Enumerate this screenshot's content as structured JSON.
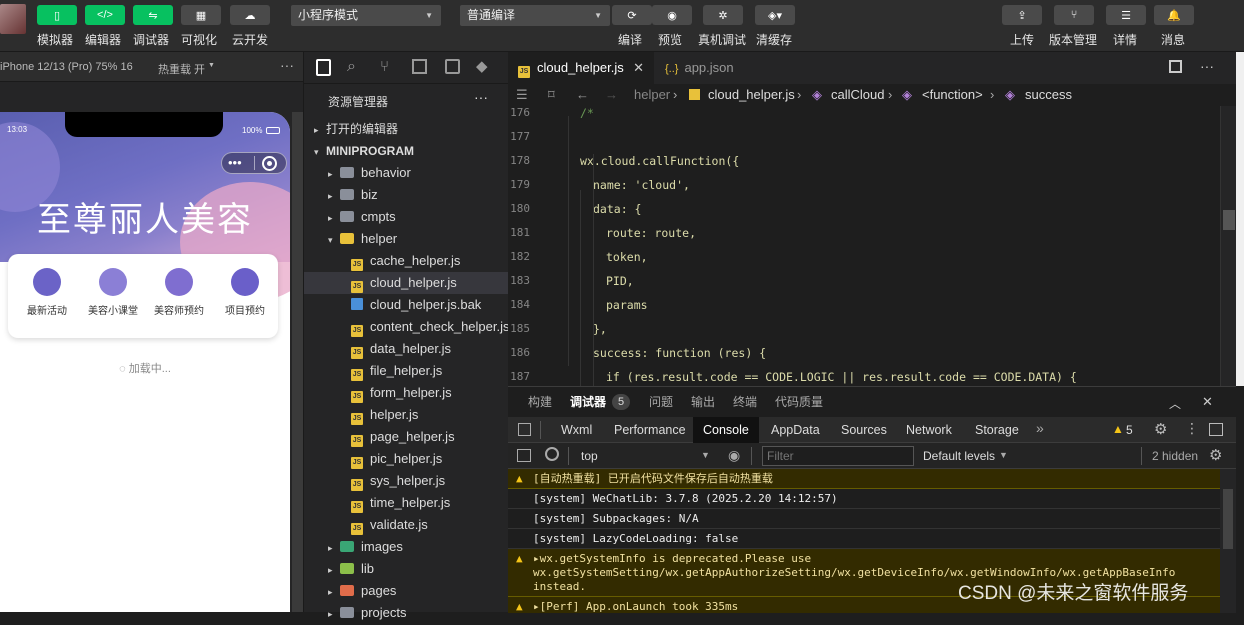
{
  "toolbar": {
    "left_buttons": [
      {
        "icon": "phone-icon",
        "label": "模拟器"
      },
      {
        "icon": "code-icon",
        "label": "编辑器"
      },
      {
        "icon": "debug-icon",
        "label": "调试器"
      },
      {
        "icon": "layout-icon",
        "label": "可视化"
      },
      {
        "icon": "cloud-icon",
        "label": "云开发"
      }
    ],
    "mode_select": "小程序模式",
    "compile_select": "普通编译",
    "mid_buttons": [
      {
        "icon": "refresh-icon",
        "label": "编译"
      },
      {
        "icon": "eye-icon",
        "label": "预览"
      },
      {
        "icon": "bug-icon",
        "label": "真机调试"
      },
      {
        "icon": "layers-icon",
        "label": "清缓存"
      }
    ],
    "right_buttons": [
      {
        "icon": "upload-icon",
        "label": "上传"
      },
      {
        "icon": "branch-icon",
        "label": "版本管理"
      },
      {
        "icon": "menu-icon",
        "label": "详情"
      },
      {
        "icon": "bell-icon",
        "label": "消息"
      }
    ]
  },
  "simulator": {
    "device": "iPhone 12/13 (Pro) 75% 16",
    "hot_reload": "热重载 开",
    "time": "13:03",
    "battery": "100%",
    "brand_title": "至尊丽人美容",
    "menu": [
      {
        "icon": "shop-icon",
        "label": "最新活动",
        "color": "#6b63c7"
      },
      {
        "icon": "badge-icon",
        "label": "美容小课堂",
        "color": "#8b7fd6"
      },
      {
        "icon": "beautician-icon",
        "label": "美容师预约",
        "color": "#7f6ed0"
      },
      {
        "icon": "user-icon",
        "label": "项目预约",
        "color": "#6a5fc9"
      }
    ],
    "loading": "加载中..."
  },
  "explorer": {
    "title": "资源管理器",
    "open_editors": "打开的编辑器",
    "root": "MINIPROGRAM",
    "items": [
      {
        "type": "folder",
        "name": "behavior",
        "indent": 0,
        "open": false
      },
      {
        "type": "folder",
        "name": "biz",
        "indent": 0,
        "open": false
      },
      {
        "type": "folder",
        "name": "cmpts",
        "indent": 0,
        "open": false
      },
      {
        "type": "folder",
        "name": "helper",
        "indent": 0,
        "open": true
      },
      {
        "type": "js",
        "name": "cache_helper.js",
        "indent": 1
      },
      {
        "type": "js",
        "name": "cloud_helper.js",
        "indent": 1,
        "selected": true
      },
      {
        "type": "file",
        "name": "cloud_helper.js.bak",
        "indent": 1
      },
      {
        "type": "js",
        "name": "content_check_helper.js",
        "indent": 1
      },
      {
        "type": "js",
        "name": "data_helper.js",
        "indent": 1
      },
      {
        "type": "js",
        "name": "file_helper.js",
        "indent": 1
      },
      {
        "type": "js",
        "name": "form_helper.js",
        "indent": 1
      },
      {
        "type": "js",
        "name": "helper.js",
        "indent": 1
      },
      {
        "type": "js",
        "name": "page_helper.js",
        "indent": 1
      },
      {
        "type": "js",
        "name": "pic_helper.js",
        "indent": 1
      },
      {
        "type": "js",
        "name": "sys_helper.js",
        "indent": 1
      },
      {
        "type": "js",
        "name": "time_helper.js",
        "indent": 1
      },
      {
        "type": "js",
        "name": "validate.js",
        "indent": 1
      },
      {
        "type": "folder",
        "name": "images",
        "indent": 0,
        "open": false,
        "color": "#3aa675"
      },
      {
        "type": "folder",
        "name": "lib",
        "indent": 0,
        "open": false,
        "color": "#8cbf4a"
      },
      {
        "type": "folder",
        "name": "pages",
        "indent": 0,
        "open": false,
        "color": "#e06c4a"
      },
      {
        "type": "folder",
        "name": "projects",
        "indent": 0,
        "open": false
      }
    ]
  },
  "editor": {
    "tabs": [
      {
        "name": "cloud_helper.js",
        "active": true,
        "icon": "JS"
      },
      {
        "name": "app.json",
        "active": false,
        "icon": "{..}"
      }
    ],
    "breadcrumb": [
      "helper",
      "cloud_helper.js",
      "callCloud",
      "<function>",
      "success"
    ],
    "lines": [
      {
        "n": "176",
        "text": "/*",
        "indent": 0,
        "color": "#6a9955"
      },
      {
        "n": "177",
        "text": "",
        "indent": 0
      },
      {
        "n": "178",
        "text": "wx.cloud.callFunction({",
        "indent": 0
      },
      {
        "n": "179",
        "text": "name: 'cloud',",
        "indent": 1
      },
      {
        "n": "180",
        "text": "data: {",
        "indent": 1
      },
      {
        "n": "181",
        "text": "route: route,",
        "indent": 2
      },
      {
        "n": "182",
        "text": "token,",
        "indent": 2
      },
      {
        "n": "183",
        "text": "PID,",
        "indent": 2
      },
      {
        "n": "184",
        "text": "params",
        "indent": 2
      },
      {
        "n": "185",
        "text": "},",
        "indent": 1
      },
      {
        "n": "186",
        "text": "success: function (res) {",
        "indent": 1
      },
      {
        "n": "187",
        "text": "if (res.result.code == CODE.LOGIC || res.result.code == CODE.DATA) {",
        "indent": 2
      }
    ]
  },
  "panel": {
    "tabs": [
      "构建",
      "调试器",
      "问题",
      "输出",
      "终端",
      "代码质量"
    ],
    "debugger_count": "5",
    "devtools_tabs": [
      "Wxml",
      "Performance",
      "Console",
      "AppData",
      "Sources",
      "Network",
      "Storage"
    ],
    "warn_count": "5",
    "context": "top",
    "filter_placeholder": "Filter",
    "levels": "Default levels",
    "hidden": "2 hidden",
    "logs": [
      {
        "level": "warn",
        "text": "[自动热重载] 已开启代码文件保存后自动热重载"
      },
      {
        "level": "info",
        "text": "[system] WeChatLib: 3.7.8 (2025.2.20 14:12:57)"
      },
      {
        "level": "info",
        "text": "[system] Subpackages: N/A"
      },
      {
        "level": "info",
        "text": "[system] LazyCodeLoading: false"
      },
      {
        "level": "warn",
        "text": "▸wx.getSystemInfo is deprecated.Please use\nwx.getSystemSetting/wx.getAppAuthorizeSetting/wx.getDeviceInfo/wx.getWindowInfo/wx.getAppBaseInfo\ninstead."
      },
      {
        "level": "warn",
        "text": "▸[Perf] App.onLaunch took 335ms"
      }
    ]
  },
  "watermark": "CSDN @未来之窗软件服务"
}
